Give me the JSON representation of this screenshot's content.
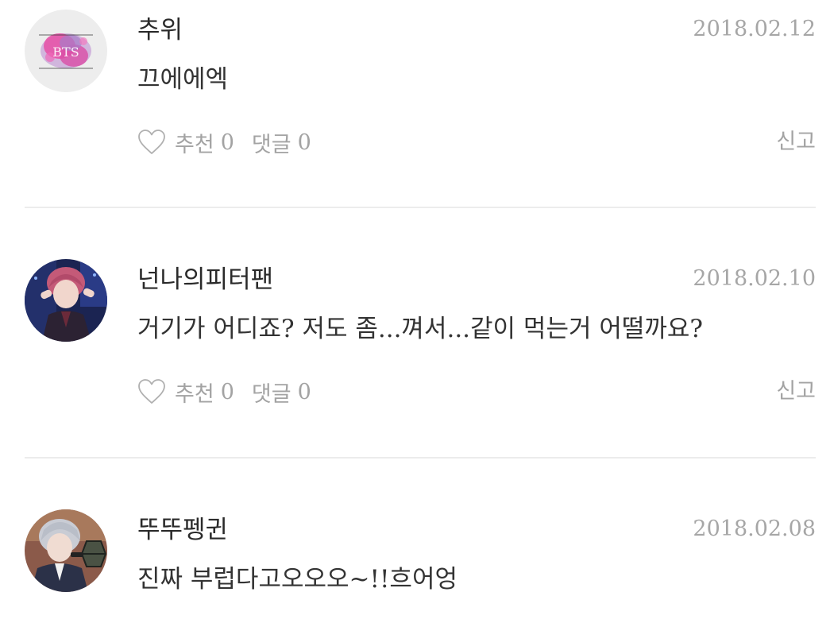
{
  "comments": [
    {
      "author": "추위",
      "date": "2018.02.12",
      "text": "끄에에엑",
      "like_label": "추천",
      "like_count": "0",
      "reply_label": "댓글",
      "reply_count": "0",
      "report_label": "신고",
      "avatar_text": "BTS"
    },
    {
      "author": "넌나의피터팬",
      "date": "2018.02.10",
      "text": "거기가 어디죠? 저도 좀...껴서...같이 먹는거 어떨까요?",
      "like_label": "추천",
      "like_count": "0",
      "reply_label": "댓글",
      "reply_count": "0",
      "report_label": "신고"
    },
    {
      "author": "뚜뚜펭귄",
      "date": "2018.02.08",
      "text": "진짜 부럽다고오오오~!!흐어엉"
    }
  ],
  "colors": {
    "author": "#2a2a2a",
    "body": "#333333",
    "muted": "#a3a3a3",
    "divider": "#ececec"
  }
}
